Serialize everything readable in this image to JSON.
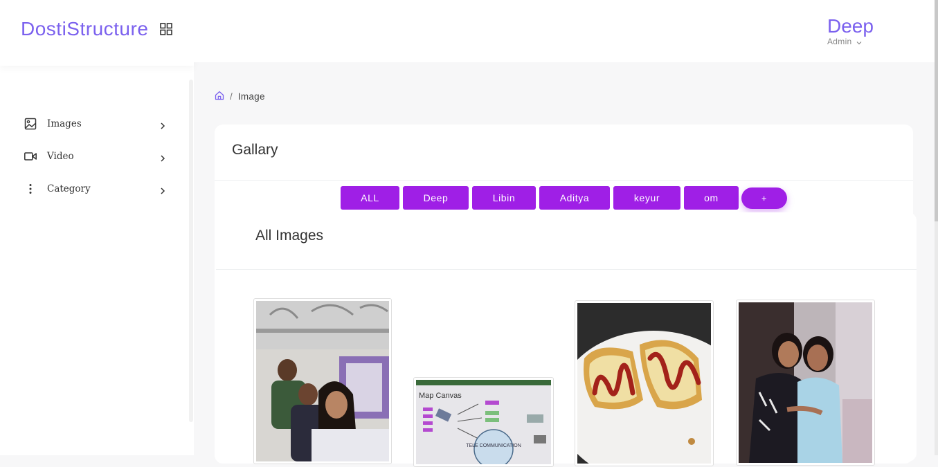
{
  "brand": {
    "name": "DostiStructure",
    "menu_icon": "grid-icon"
  },
  "sidebar": {
    "items": [
      {
        "label": "Images",
        "icon": "image-icon"
      },
      {
        "label": "Video",
        "icon": "video-icon"
      },
      {
        "label": "Category",
        "icon": "more-vertical-icon"
      }
    ]
  },
  "header": {
    "user_name": "Deep",
    "user_role": "Admin"
  },
  "breadcrumb": {
    "home_icon": "home-icon",
    "separator": "/",
    "current": "Image"
  },
  "gallery": {
    "title": "Gallary",
    "filters": [
      "ALL",
      "Deep",
      "Libin",
      "Aditya",
      "keyur",
      "om"
    ],
    "add_label": "+",
    "section_title": "All Images",
    "accent": "#9f1fe6",
    "brand_color": "#7b61ee",
    "photos": [
      {
        "name": "selfie-photo"
      },
      {
        "name": "map-canvas-photo",
        "text": "Map Canvas",
        "subtext": "TELE COMMUNICATION"
      },
      {
        "name": "pizza-bread-photo"
      },
      {
        "name": "friends-photo"
      }
    ]
  }
}
